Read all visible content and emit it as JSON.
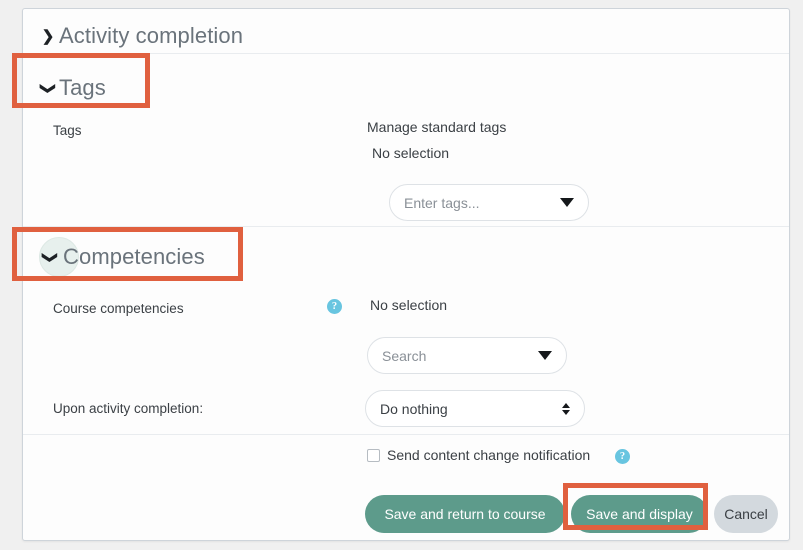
{
  "theme": {
    "page_bg": "#f0f0f0",
    "card_bg": "#fdfdfd",
    "highlight_color": "#e0603f",
    "primary_button_color": "#5d9b8b",
    "secondary_button_color": "#d3d9de",
    "help_icon_color": "#68c5e0",
    "title_color": "#6a737b"
  },
  "sections": {
    "activity_completion": {
      "title": "Activity completion",
      "chevron": "chevron-right-icon",
      "expanded": false,
      "highlighted": false
    },
    "tags": {
      "title": "Tags",
      "chevron": "chevron-down-icon",
      "expanded": true,
      "highlighted": true,
      "field_label": "Tags",
      "manage_link": "Manage standard tags",
      "selection_text": "No selection",
      "input_placeholder": "Enter tags...",
      "input_value": "",
      "dropdown_icon": "caret-down-icon"
    },
    "competencies": {
      "title": "Competencies",
      "chevron": "chevron-down-icon",
      "expanded": true,
      "highlighted": true,
      "focused": true,
      "course_competencies_label": "Course competencies",
      "course_competencies_help": "help-icon",
      "selection_text": "No selection",
      "search_placeholder": "Search",
      "search_value": "",
      "dropdown_icon": "caret-down-icon",
      "upon_completion_label": "Upon activity completion:",
      "upon_completion_value": "Do nothing",
      "upon_completion_options": [
        "Do nothing"
      ]
    }
  },
  "footer": {
    "notification_checkbox_label": "Send content change notification",
    "notification_checkbox_checked": false,
    "notification_help": "help-icon",
    "save_return_label": "Save and return to course",
    "save_display_label": "Save and display",
    "save_display_highlighted": true,
    "cancel_label": "Cancel"
  }
}
